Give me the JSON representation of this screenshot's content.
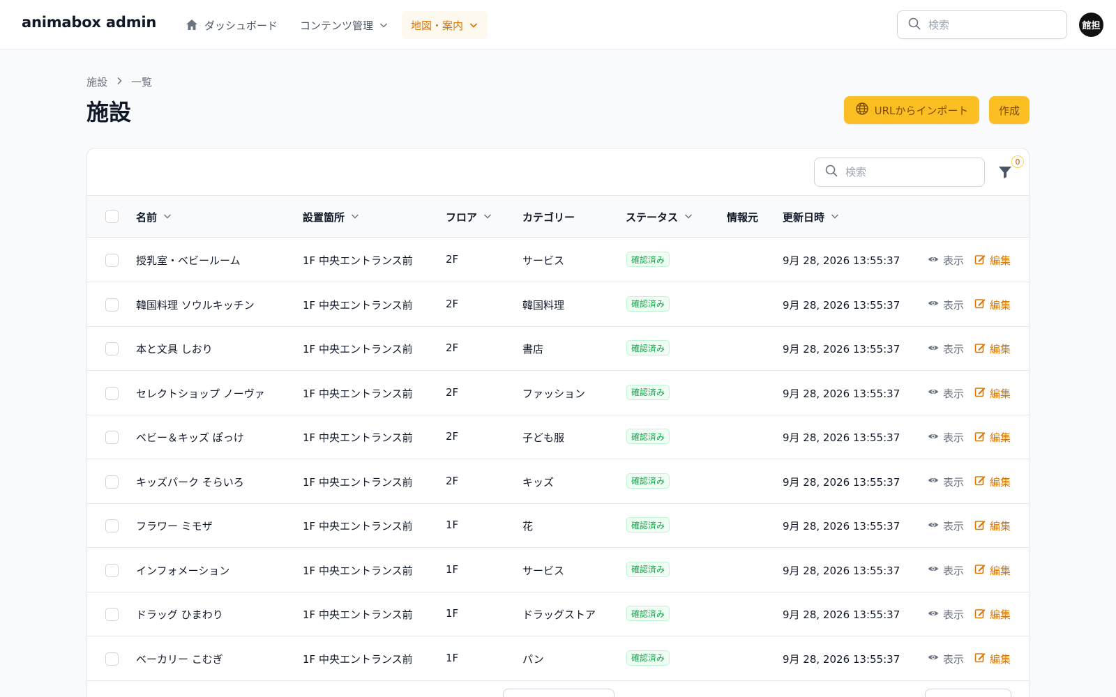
{
  "app": {
    "brand": "animabox admin",
    "nav": [
      {
        "label": "ダッシュボード",
        "icon": "home-icon"
      },
      {
        "label": "コンテンツ管理",
        "icon": "chevron-down-icon"
      },
      {
        "label": "地図・案内",
        "icon": "chevron-down-icon",
        "active": true
      }
    ],
    "search_placeholder": "検索",
    "avatar": "館担"
  },
  "breadcrumb": {
    "parent": "施設",
    "current": "一覧"
  },
  "page": {
    "title": "施設",
    "import_button": "URLからインポート",
    "create_button": "作成"
  },
  "table": {
    "search_placeholder": "検索",
    "filter_count": "0",
    "columns": [
      "名前",
      "設置箇所",
      "フロア",
      "カテゴリー",
      "ステータス",
      "情報元",
      "更新日時"
    ],
    "view_label": "表示",
    "edit_label": "編集",
    "rows": [
      {
        "name": "授乳室・ベビールーム",
        "location": "1F 中央エントランス前",
        "floor": "2F",
        "category": "サービス",
        "status": "確認済み",
        "source": "",
        "updated": "9月 28, 2026 13:55:37"
      },
      {
        "name": "韓国料理 ソウルキッチン",
        "location": "1F 中央エントランス前",
        "floor": "2F",
        "category": "韓国料理",
        "status": "確認済み",
        "source": "",
        "updated": "9月 28, 2026 13:55:37"
      },
      {
        "name": "本と文具 しおり",
        "location": "1F 中央エントランス前",
        "floor": "2F",
        "category": "書店",
        "status": "確認済み",
        "source": "",
        "updated": "9月 28, 2026 13:55:37"
      },
      {
        "name": "セレクトショップ ノーヴァ",
        "location": "1F 中央エントランス前",
        "floor": "2F",
        "category": "ファッション",
        "status": "確認済み",
        "source": "",
        "updated": "9月 28, 2026 13:55:37"
      },
      {
        "name": "ベビー＆キッズ ぽっけ",
        "location": "1F 中央エントランス前",
        "floor": "2F",
        "category": "子ども服",
        "status": "確認済み",
        "source": "",
        "updated": "9月 28, 2026 13:55:37"
      },
      {
        "name": "キッズパーク そらいろ",
        "location": "1F 中央エントランス前",
        "floor": "2F",
        "category": "キッズ",
        "status": "確認済み",
        "source": "",
        "updated": "9月 28, 2026 13:55:37"
      },
      {
        "name": "フラワー ミモザ",
        "location": "1F 中央エントランス前",
        "floor": "1F",
        "category": "花",
        "status": "確認済み",
        "source": "",
        "updated": "9月 28, 2026 13:55:37"
      },
      {
        "name": "インフォメーション",
        "location": "1F 中央エントランス前",
        "floor": "1F",
        "category": "サービス",
        "status": "確認済み",
        "source": "",
        "updated": "9月 28, 2026 13:55:37"
      },
      {
        "name": "ドラッグ ひまわり",
        "location": "1F 中央エントランス前",
        "floor": "1F",
        "category": "ドラッグストア",
        "status": "確認済み",
        "source": "",
        "updated": "9月 28, 2026 13:55:37"
      },
      {
        "name": "ベーカリー こむぎ",
        "location": "1F 中央エントランス前",
        "floor": "1F",
        "category": "パン",
        "status": "確認済み",
        "source": "",
        "updated": "9月 28, 2026 13:55:37"
      }
    ]
  },
  "colors": {
    "accent": "#fbbf24",
    "accent_text": "#d97706",
    "status_ok": "#16a34a"
  }
}
